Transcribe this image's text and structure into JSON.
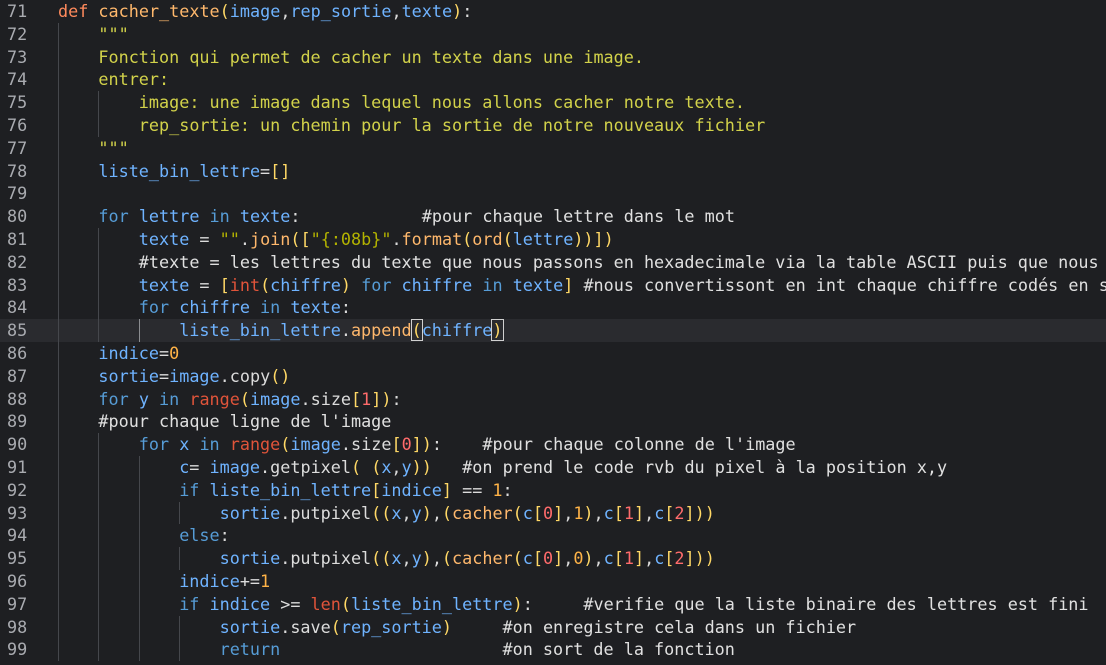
{
  "editor": {
    "language": "python",
    "current_line": 85,
    "lines": [
      {
        "n": "71",
        "indent": 0,
        "tokens": [
          [
            "def ",
            "t-def"
          ],
          [
            "cacher_texte",
            "t-fn"
          ],
          [
            "(",
            "t-par"
          ],
          [
            "image",
            "t-var"
          ],
          [
            ",",
            "t-op"
          ],
          [
            "rep_sortie",
            "t-var"
          ],
          [
            ",",
            "t-op"
          ],
          [
            "texte",
            "t-var"
          ],
          [
            ")",
            "t-par"
          ],
          [
            ":",
            "t-op"
          ]
        ]
      },
      {
        "n": "72",
        "indent": 1,
        "tokens": [
          [
            "\"\"\"",
            "t-doc"
          ]
        ]
      },
      {
        "n": "73",
        "indent": 1,
        "tokens": [
          [
            "Fonction qui permet de cacher un texte dans une image.",
            "t-doc"
          ]
        ]
      },
      {
        "n": "74",
        "indent": 1,
        "tokens": [
          [
            "entrer:",
            "t-doc"
          ]
        ]
      },
      {
        "n": "75",
        "indent": 2,
        "tokens": [
          [
            "image: une image dans lequel nous allons cacher notre texte.",
            "t-doc"
          ]
        ]
      },
      {
        "n": "76",
        "indent": 2,
        "tokens": [
          [
            "rep_sortie: un chemin pour la sortie de notre nouveaux fichier",
            "t-doc"
          ]
        ]
      },
      {
        "n": "77",
        "indent": 1,
        "tokens": [
          [
            "\"\"\"",
            "t-doc"
          ]
        ]
      },
      {
        "n": "78",
        "indent": 1,
        "tokens": [
          [
            "liste_bin_lettre",
            "t-var"
          ],
          [
            "=",
            "t-op"
          ],
          [
            "[]",
            "t-par"
          ]
        ]
      },
      {
        "n": "79",
        "indent": 1,
        "tokens": []
      },
      {
        "n": "80",
        "indent": 1,
        "tokens": [
          [
            "for ",
            "t-kw"
          ],
          [
            "lettre ",
            "t-var"
          ],
          [
            "in ",
            "t-kw"
          ],
          [
            "texte",
            "t-var"
          ],
          [
            ":            ",
            "t-op"
          ],
          [
            "#pour chaque lettre dans le mot",
            "t-com"
          ]
        ]
      },
      {
        "n": "81",
        "indent": 2,
        "tokens": [
          [
            "texte ",
            "t-var"
          ],
          [
            "= ",
            "t-op"
          ],
          [
            "\"\"",
            "t-str"
          ],
          [
            ".",
            "t-op"
          ],
          [
            "join",
            "t-fn"
          ],
          [
            "(",
            "t-par"
          ],
          [
            "[",
            "t-par"
          ],
          [
            "\"{:08b}\"",
            "t-str"
          ],
          [
            ".",
            "t-op"
          ],
          [
            "format",
            "t-fn"
          ],
          [
            "(",
            "t-par"
          ],
          [
            "ord",
            "t-fn"
          ],
          [
            "(",
            "t-par"
          ],
          [
            "lettre",
            "t-var"
          ],
          [
            "))",
            "t-par"
          ],
          [
            "])",
            "t-par"
          ]
        ]
      },
      {
        "n": "82",
        "indent": 2,
        "tokens": [
          [
            "#texte = les lettres du texte que nous passons en hexadecimale via la table ASCII puis que nous",
            "t-com"
          ]
        ]
      },
      {
        "n": "83",
        "indent": 2,
        "tokens": [
          [
            "texte ",
            "t-var"
          ],
          [
            "= ",
            "t-op"
          ],
          [
            "[",
            "t-par"
          ],
          [
            "int",
            "t-bi"
          ],
          [
            "(",
            "t-par"
          ],
          [
            "chiffre",
            "t-var"
          ],
          [
            ") ",
            "t-par"
          ],
          [
            "for ",
            "t-kw"
          ],
          [
            "chiffre ",
            "t-var"
          ],
          [
            "in ",
            "t-kw"
          ],
          [
            "texte",
            "t-var"
          ],
          [
            "] ",
            "t-par"
          ],
          [
            "#nous convertissont en int chaque chiffre codés en s",
            "t-com"
          ]
        ]
      },
      {
        "n": "84",
        "indent": 2,
        "tokens": [
          [
            "for ",
            "t-kw"
          ],
          [
            "chiffre ",
            "t-var"
          ],
          [
            "in ",
            "t-kw"
          ],
          [
            "texte",
            "t-var"
          ],
          [
            ":",
            "t-op"
          ]
        ]
      },
      {
        "n": "85",
        "indent": 3,
        "tokens": [
          [
            "liste_bin_lettre",
            "t-var"
          ],
          [
            ".",
            "t-op"
          ],
          [
            "append",
            "t-fn"
          ],
          [
            "(",
            "t-par"
          ],
          [
            "chiffre",
            "t-var"
          ],
          [
            ")",
            "t-par"
          ]
        ]
      },
      {
        "n": "86",
        "indent": 1,
        "tokens": [
          [
            "indice",
            "t-var"
          ],
          [
            "=",
            "t-op"
          ],
          [
            "0",
            "t-nm"
          ]
        ]
      },
      {
        "n": "87",
        "indent": 1,
        "tokens": [
          [
            "sortie",
            "t-var"
          ],
          [
            "=",
            "t-op"
          ],
          [
            "image",
            "t-var"
          ],
          [
            ".",
            "t-op"
          ],
          [
            "copy",
            "t-pl"
          ],
          [
            "()",
            "t-par"
          ]
        ]
      },
      {
        "n": "88",
        "indent": 1,
        "tokens": [
          [
            "for ",
            "t-kw"
          ],
          [
            "y ",
            "t-var"
          ],
          [
            "in ",
            "t-kw"
          ],
          [
            "range",
            "t-bi"
          ],
          [
            "(",
            "t-par"
          ],
          [
            "image",
            "t-var"
          ],
          [
            ".",
            "t-op"
          ],
          [
            "size",
            "t-pl"
          ],
          [
            "[",
            "t-par"
          ],
          [
            "1",
            "t-num"
          ],
          [
            "]",
            "t-par"
          ],
          [
            ")",
            "t-par"
          ],
          [
            ":",
            "t-op"
          ]
        ]
      },
      {
        "n": "89",
        "indent": 1,
        "tokens": [
          [
            "#pour chaque ligne de l'image",
            "t-com"
          ]
        ]
      },
      {
        "n": "90",
        "indent": 2,
        "tokens": [
          [
            "for ",
            "t-kw"
          ],
          [
            "x ",
            "t-var"
          ],
          [
            "in ",
            "t-kw"
          ],
          [
            "range",
            "t-bi"
          ],
          [
            "(",
            "t-par"
          ],
          [
            "image",
            "t-var"
          ],
          [
            ".",
            "t-op"
          ],
          [
            "size",
            "t-pl"
          ],
          [
            "[",
            "t-par"
          ],
          [
            "0",
            "t-num"
          ],
          [
            "]",
            "t-par"
          ],
          [
            ")",
            "t-par"
          ],
          [
            ":    ",
            "t-op"
          ],
          [
            "#pour chaque colonne de l'image",
            "t-com"
          ]
        ]
      },
      {
        "n": "91",
        "indent": 3,
        "tokens": [
          [
            "c",
            "t-var"
          ],
          [
            "= ",
            "t-op"
          ],
          [
            "image",
            "t-var"
          ],
          [
            ".",
            "t-op"
          ],
          [
            "getpixel",
            "t-pl"
          ],
          [
            "( ",
            "t-par"
          ],
          [
            "(",
            "t-par"
          ],
          [
            "x",
            "t-var"
          ],
          [
            ",",
            "t-op"
          ],
          [
            "y",
            "t-var"
          ],
          [
            "))   ",
            "t-par"
          ],
          [
            "#on prend le code rvb du pixel à la position x,y",
            "t-com"
          ]
        ]
      },
      {
        "n": "92",
        "indent": 3,
        "tokens": [
          [
            "if ",
            "t-kw"
          ],
          [
            "liste_bin_lettre",
            "t-var"
          ],
          [
            "[",
            "t-par"
          ],
          [
            "indice",
            "t-var"
          ],
          [
            "] ",
            "t-par"
          ],
          [
            "== ",
            "t-op"
          ],
          [
            "1",
            "t-nm"
          ],
          [
            ":",
            "t-op"
          ]
        ]
      },
      {
        "n": "93",
        "indent": 4,
        "tokens": [
          [
            "sortie",
            "t-var"
          ],
          [
            ".",
            "t-op"
          ],
          [
            "putpixel",
            "t-pl"
          ],
          [
            "((",
            "t-par"
          ],
          [
            "x",
            "t-var"
          ],
          [
            ",",
            "t-op"
          ],
          [
            "y",
            "t-var"
          ],
          [
            ")",
            "t-par"
          ],
          [
            ",",
            "t-op"
          ],
          [
            "(",
            "t-par"
          ],
          [
            "cacher",
            "t-fn"
          ],
          [
            "(",
            "t-par"
          ],
          [
            "c",
            "t-var"
          ],
          [
            "[",
            "t-par"
          ],
          [
            "0",
            "t-num"
          ],
          [
            "]",
            "t-par"
          ],
          [
            ",",
            "t-op"
          ],
          [
            "1",
            "t-nm"
          ],
          [
            ")",
            "t-par"
          ],
          [
            ",",
            "t-op"
          ],
          [
            "c",
            "t-var"
          ],
          [
            "[",
            "t-par"
          ],
          [
            "1",
            "t-num"
          ],
          [
            "]",
            "t-par"
          ],
          [
            ",",
            "t-op"
          ],
          [
            "c",
            "t-var"
          ],
          [
            "[",
            "t-par"
          ],
          [
            "2",
            "t-num"
          ],
          [
            "]))",
            "t-par"
          ]
        ]
      },
      {
        "n": "94",
        "indent": 3,
        "tokens": [
          [
            "else",
            "t-kw"
          ],
          [
            ":",
            "t-op"
          ]
        ]
      },
      {
        "n": "95",
        "indent": 4,
        "tokens": [
          [
            "sortie",
            "t-var"
          ],
          [
            ".",
            "t-op"
          ],
          [
            "putpixel",
            "t-pl"
          ],
          [
            "((",
            "t-par"
          ],
          [
            "x",
            "t-var"
          ],
          [
            ",",
            "t-op"
          ],
          [
            "y",
            "t-var"
          ],
          [
            ")",
            "t-par"
          ],
          [
            ",",
            "t-op"
          ],
          [
            "(",
            "t-par"
          ],
          [
            "cacher",
            "t-fn"
          ],
          [
            "(",
            "t-par"
          ],
          [
            "c",
            "t-var"
          ],
          [
            "[",
            "t-par"
          ],
          [
            "0",
            "t-num"
          ],
          [
            "]",
            "t-par"
          ],
          [
            ",",
            "t-op"
          ],
          [
            "0",
            "t-nm"
          ],
          [
            ")",
            "t-par"
          ],
          [
            ",",
            "t-op"
          ],
          [
            "c",
            "t-var"
          ],
          [
            "[",
            "t-par"
          ],
          [
            "1",
            "t-num"
          ],
          [
            "]",
            "t-par"
          ],
          [
            ",",
            "t-op"
          ],
          [
            "c",
            "t-var"
          ],
          [
            "[",
            "t-par"
          ],
          [
            "2",
            "t-num"
          ],
          [
            "]))",
            "t-par"
          ]
        ]
      },
      {
        "n": "96",
        "indent": 3,
        "tokens": [
          [
            "indice",
            "t-var"
          ],
          [
            "+=",
            "t-op"
          ],
          [
            "1",
            "t-nm"
          ]
        ]
      },
      {
        "n": "97",
        "indent": 3,
        "tokens": [
          [
            "if ",
            "t-kw"
          ],
          [
            "indice ",
            "t-var"
          ],
          [
            ">= ",
            "t-op"
          ],
          [
            "len",
            "t-bi"
          ],
          [
            "(",
            "t-par"
          ],
          [
            "liste_bin_lettre",
            "t-var"
          ],
          [
            ")",
            "t-par"
          ],
          [
            ":     ",
            "t-op"
          ],
          [
            "#verifie que la liste binaire des lettres est fini",
            "t-com"
          ]
        ]
      },
      {
        "n": "98",
        "indent": 4,
        "tokens": [
          [
            "sortie",
            "t-var"
          ],
          [
            ".",
            "t-op"
          ],
          [
            "save",
            "t-pl"
          ],
          [
            "(",
            "t-par"
          ],
          [
            "rep_sortie",
            "t-var"
          ],
          [
            ")     ",
            "t-par"
          ],
          [
            "#on enregistre cela dans un fichier",
            "t-com"
          ]
        ]
      },
      {
        "n": "99",
        "indent": 4,
        "tokens": [
          [
            "return                      ",
            "t-kw"
          ],
          [
            "#on sort de la fonction",
            "t-com"
          ]
        ]
      }
    ]
  }
}
